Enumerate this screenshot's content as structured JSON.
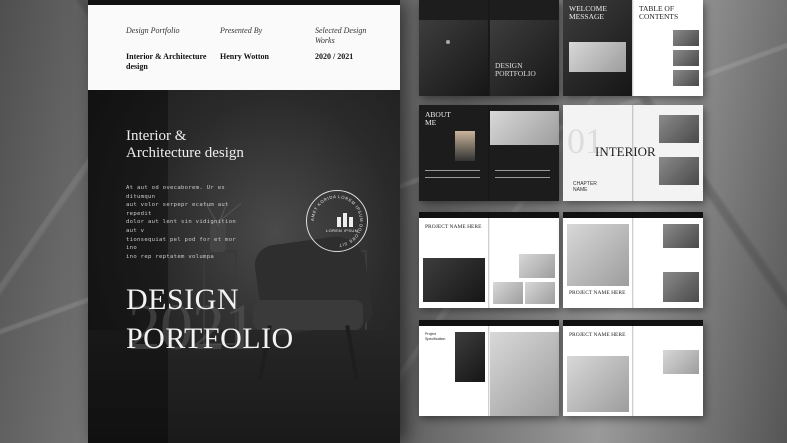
{
  "cover": {
    "meta_1_label": "Design Portfolio",
    "meta_1_value": "Interior & Architecture design",
    "meta_2_label": "Presented By",
    "meta_2_value": "Henry Wotton",
    "meta_3_label": "Selected Design Works",
    "meta_3_value": "2020 / 2021",
    "subtitle_line1": "Interior &",
    "subtitle_line2": "Architecture design",
    "lorem_1": "At aut od ovecaborem. Ur es ditumqun",
    "lorem_2": "aut volor serpepr ecatum aut repedit",
    "lorem_3": "dolor aut lent sin vidignition aut v",
    "lorem_4": "tionsequiat pel pod for et mor ino",
    "lorem_5": "ino rep reptatem volumpa",
    "title_line1": "DESIGN",
    "title_line2": "PORTFOLIO",
    "year_watermark": "2021",
    "seal_name": "LOREM IPSUM",
    "seal_ring_text": "AMET KORIDA LOREM IPSUM DOLORE SIT"
  },
  "spreads": {
    "s1_title_1": "DESIGN",
    "s1_title_2": "PORTFOLIO",
    "s2_left": "WELCOME MESSAGE",
    "s2_right": "TABLE OF CONTENTS",
    "s3_left": "ABOUT ME",
    "s4_number": "01",
    "s4_title": "INTERIOR",
    "s4_chapter": "CHAPTER NAME",
    "s5_project": "PROJECT NAME HERE",
    "s6_project": "PROJECT NAME HERE",
    "s7_project_spec": "Project Specification",
    "s8_project": "PROJECT NAME HERE"
  },
  "colors": {
    "dark": "#1b1b1b",
    "paper": "#fafafa"
  }
}
